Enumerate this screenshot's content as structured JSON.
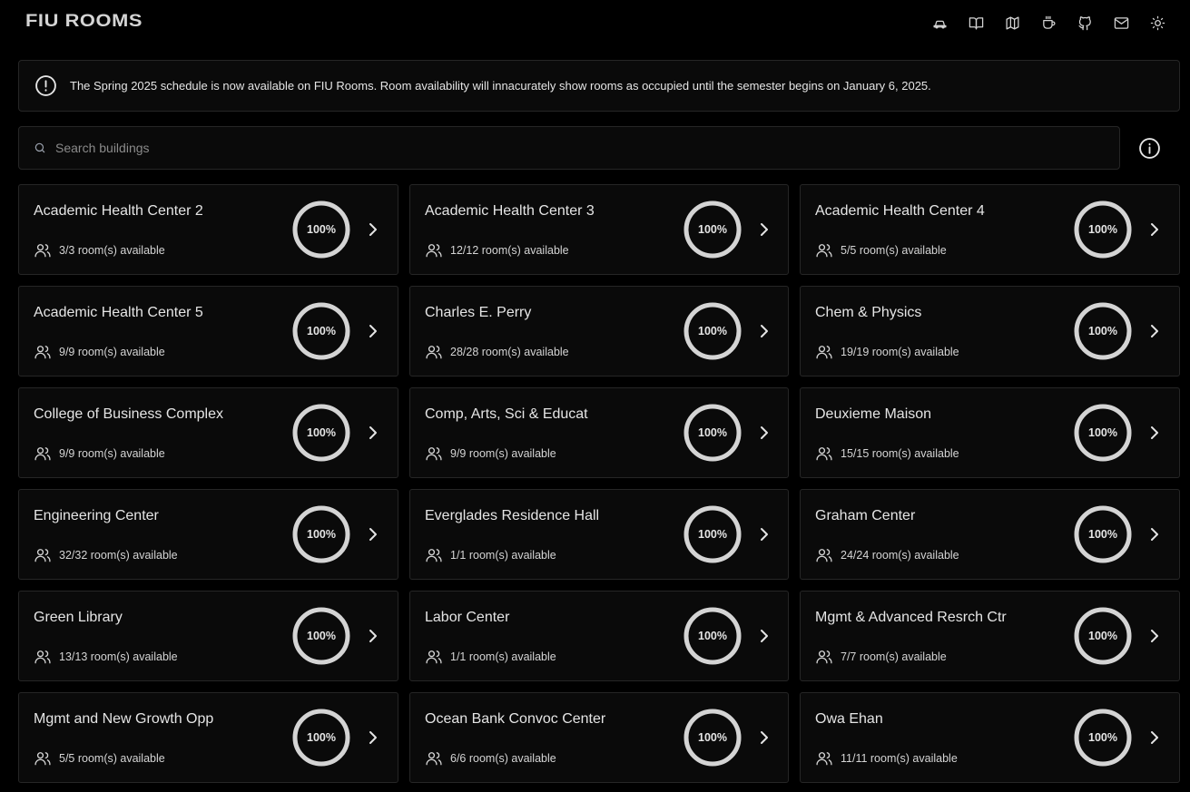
{
  "app": {
    "title": "FIU ROOMS"
  },
  "nav": {
    "icons": [
      "car-icon",
      "book-icon",
      "map-icon",
      "coffee-icon",
      "github-icon",
      "mail-icon",
      "sun-icon"
    ]
  },
  "banner": {
    "icon": "alert-circle-icon",
    "text": "The Spring 2025 schedule is now available on FIU Rooms. Room availability will innacurately show rooms as occupied until the semester begins on January 6, 2025."
  },
  "search": {
    "placeholder": "Search buildings",
    "value": ""
  },
  "colors": {
    "background": "#000000",
    "card": "#0a0a0a",
    "border": "#262626",
    "ring": "#d4d4d4",
    "text": "#e5e5e5"
  },
  "buildings": [
    {
      "name": "Academic Health Center 2",
      "availability": "3/3 room(s) available",
      "percent_label": "100%",
      "percent": 100
    },
    {
      "name": "Academic Health Center 3",
      "availability": "12/12 room(s) available",
      "percent_label": "100%",
      "percent": 100
    },
    {
      "name": "Academic Health Center 4",
      "availability": "5/5 room(s) available",
      "percent_label": "100%",
      "percent": 100
    },
    {
      "name": "Academic Health Center 5",
      "availability": "9/9 room(s) available",
      "percent_label": "100%",
      "percent": 100
    },
    {
      "name": "Charles E. Perry",
      "availability": "28/28 room(s) available",
      "percent_label": "100%",
      "percent": 100
    },
    {
      "name": "Chem & Physics",
      "availability": "19/19 room(s) available",
      "percent_label": "100%",
      "percent": 100
    },
    {
      "name": "College of Business Complex",
      "availability": "9/9 room(s) available",
      "percent_label": "100%",
      "percent": 100
    },
    {
      "name": "Comp, Arts, Sci & Educat",
      "availability": "9/9 room(s) available",
      "percent_label": "100%",
      "percent": 100
    },
    {
      "name": "Deuxieme Maison",
      "availability": "15/15 room(s) available",
      "percent_label": "100%",
      "percent": 100
    },
    {
      "name": "Engineering Center",
      "availability": "32/32 room(s) available",
      "percent_label": "100%",
      "percent": 100
    },
    {
      "name": "Everglades Residence Hall",
      "availability": "1/1 room(s) available",
      "percent_label": "100%",
      "percent": 100
    },
    {
      "name": "Graham Center",
      "availability": "24/24 room(s) available",
      "percent_label": "100%",
      "percent": 100
    },
    {
      "name": "Green Library",
      "availability": "13/13 room(s) available",
      "percent_label": "100%",
      "percent": 100
    },
    {
      "name": "Labor Center",
      "availability": "1/1 room(s) available",
      "percent_label": "100%",
      "percent": 100
    },
    {
      "name": "Mgmt & Advanced Resrch Ctr",
      "availability": "7/7 room(s) available",
      "percent_label": "100%",
      "percent": 100
    },
    {
      "name": "Mgmt and New Growth Opp",
      "availability": "5/5 room(s) available",
      "percent_label": "100%",
      "percent": 100
    },
    {
      "name": "Ocean Bank Convoc Center",
      "availability": "6/6 room(s) available",
      "percent_label": "100%",
      "percent": 100
    },
    {
      "name": "Owa Ehan",
      "availability": "11/11 room(s) available",
      "percent_label": "100%",
      "percent": 100
    }
  ]
}
